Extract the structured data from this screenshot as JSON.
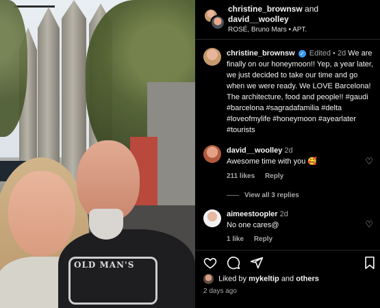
{
  "header": {
    "user1": "christine_brownsw",
    "and_text": "and",
    "user2": "david__woolley",
    "music": "ROSÉ, Bruno Mars • APT."
  },
  "caption": {
    "username": "christine_brownsw",
    "edited": "Edited",
    "time": "2d",
    "text": "We are finally on our honeymoon!! Yep, a year later, we just decided to take our time and go when we were ready. We LOVE Barcelona! The architecture, food and people!! #gaudi #barcelona #sagradafamilia #delta #loveofmylife #honeymoon #ayearlater #tourists"
  },
  "comments": [
    {
      "username": "david__woolley",
      "time": "2d",
      "text": "Awesome time with you 🥰",
      "likes": "211 likes",
      "reply": "Reply",
      "view_replies": "View all 3 replies"
    },
    {
      "username": "aimeestoopler",
      "time": "2d",
      "text": "No one cares@",
      "likes": "1 like",
      "reply": "Reply"
    }
  ],
  "photo": {
    "shirt_text": "OLD MAN'S"
  },
  "liked_by": {
    "prefix": "Liked by",
    "user": "mykeltip",
    "and": "and",
    "others": "others"
  },
  "post_date": "2 days ago",
  "icons": {
    "like": "heart-icon",
    "comment": "comment-icon",
    "share": "send-icon",
    "save": "bookmark-icon"
  }
}
